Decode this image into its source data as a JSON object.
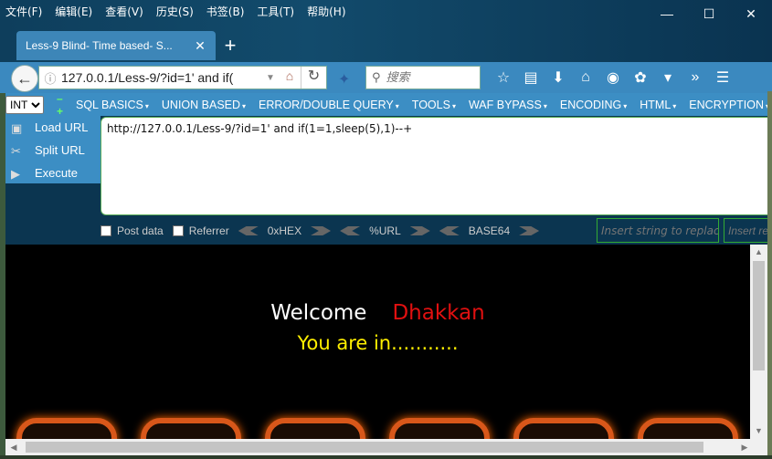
{
  "menubar": [
    "文件(F)",
    "编辑(E)",
    "查看(V)",
    "历史(S)",
    "书签(B)",
    "工具(T)",
    "帮助(H)"
  ],
  "window_controls": {
    "minimize": "—",
    "maximize": "☐",
    "close": "✕"
  },
  "tab": {
    "title": "Less-9 Blind- Time based- S...",
    "close": "✕",
    "new_tab": "+"
  },
  "navbar": {
    "url": "127.0.0.1/Less-9/?id=1' and if(",
    "search_placeholder": "搜索"
  },
  "hackbar": {
    "selected_type": "INT",
    "type_options": [
      "INT"
    ],
    "menu": [
      "SQL BASICS",
      "UNION BASED",
      "ERROR/DOUBLE QUERY",
      "TOOLS",
      "WAF BYPASS",
      "ENCODING",
      "HTML",
      "ENCRYPTION"
    ],
    "side": {
      "load": "Load URL",
      "split": "Split URL",
      "execute": "Execute"
    },
    "query": "http://127.0.0.1/Less-9/?id=1' and if(1=1,sleep(5),1)--+",
    "post_data": "Post data",
    "referrer": "Referrer",
    "hex": "0xHEX",
    "url_enc": "%URL",
    "base64": "BASE64",
    "replace_placeholder": "Insert string to replace",
    "replace_placeholder2": "Insert replacing string"
  },
  "page": {
    "welcome": "Welcome",
    "name": "Dhakkan",
    "status": "You are in..........."
  }
}
